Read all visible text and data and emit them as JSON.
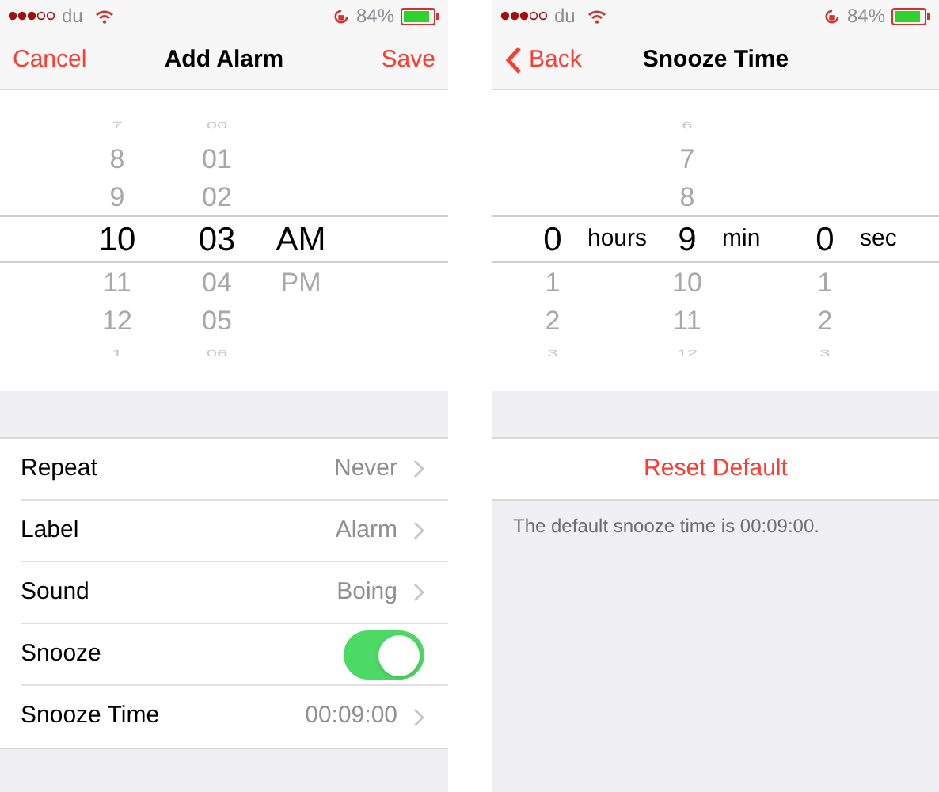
{
  "screens": [
    {
      "status_bar": {
        "carrier": "du",
        "battery": "84%"
      },
      "nav": {
        "left": {
          "label": "Cancel",
          "kind": "text"
        },
        "title": "Add Alarm",
        "right": "Save"
      },
      "picker": {
        "columns": [
          {
            "items": [
              {
                "label": "7",
                "selected": false
              },
              {
                "label": "8",
                "selected": false
              },
              {
                "label": "9",
                "selected": false
              },
              {
                "label": "10",
                "selected": true
              },
              {
                "label": "11",
                "selected": false
              },
              {
                "label": "12",
                "selected": false
              },
              {
                "label": "1",
                "selected": false
              }
            ]
          },
          {
            "items": [
              {
                "label": "00",
                "selected": false
              },
              {
                "label": "01",
                "selected": false
              },
              {
                "label": "02",
                "selected": false
              },
              {
                "label": "03",
                "selected": true
              },
              {
                "label": "04",
                "selected": false
              },
              {
                "label": "05",
                "selected": false
              },
              {
                "label": "06",
                "selected": false
              }
            ]
          },
          {
            "items": [
              {
                "label": "AM",
                "selected": true
              },
              {
                "label": "PM",
                "selected": false
              }
            ]
          }
        ]
      },
      "settings": [
        {
          "kind": "detail",
          "label": "Repeat",
          "value": "Never"
        },
        {
          "kind": "detail",
          "label": "Label",
          "value": "Alarm"
        },
        {
          "kind": "detail",
          "label": "Sound",
          "value": "Boing"
        },
        {
          "kind": "toggle",
          "label": "Snooze",
          "on": true
        },
        {
          "kind": "detail",
          "label": "Snooze Time",
          "value": "00:09:00"
        }
      ]
    },
    {
      "status_bar": {
        "carrier": "du",
        "battery": "84%"
      },
      "nav": {
        "left": {
          "label": "Back",
          "kind": "back"
        },
        "title": "Snooze Time"
      },
      "picker": {
        "columns": [
          {
            "unit": "hours",
            "items": [
              {
                "label": "0",
                "selected": true
              },
              {
                "label": "1",
                "selected": false
              },
              {
                "label": "2",
                "selected": false
              },
              {
                "label": "3",
                "selected": false
              }
            ]
          },
          {
            "unit": "min",
            "items": [
              {
                "label": "6",
                "selected": false
              },
              {
                "label": "7",
                "selected": false
              },
              {
                "label": "8",
                "selected": false
              },
              {
                "label": "9",
                "selected": true
              },
              {
                "label": "10",
                "selected": false
              },
              {
                "label": "11",
                "selected": false
              },
              {
                "label": "12",
                "selected": false
              }
            ]
          },
          {
            "unit": "sec",
            "items": [
              {
                "label": "0",
                "selected": true
              },
              {
                "label": "1",
                "selected": false
              },
              {
                "label": "2",
                "selected": false
              },
              {
                "label": "3",
                "selected": false
              }
            ]
          }
        ]
      },
      "reset_button": "Reset Default",
      "footer": "The default snooze time is 00:09:00."
    }
  ]
}
